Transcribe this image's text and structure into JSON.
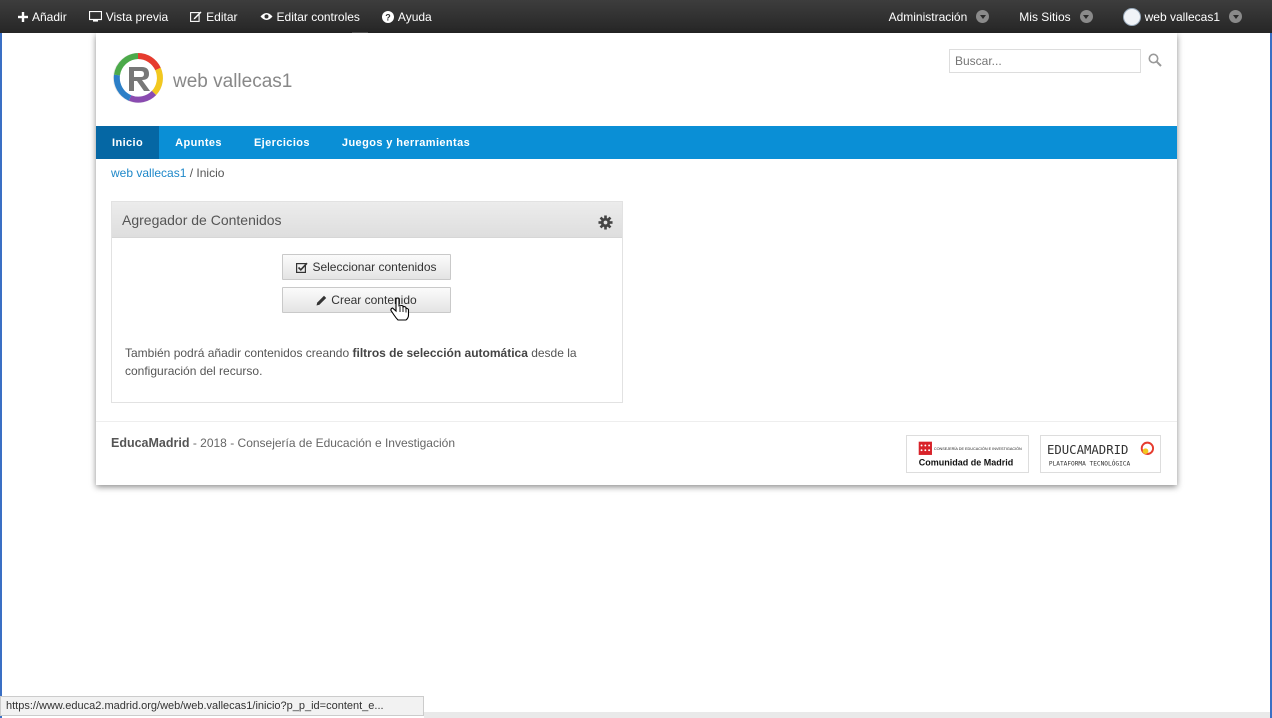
{
  "dockbar": {
    "add": "Añadir",
    "preview": "Vista previa",
    "edit": "Editar",
    "edit_controls": "Editar controles",
    "help": "Ayuda",
    "admin": "Administración",
    "my_sites": "Mis Sitios",
    "user": "web vallecas1"
  },
  "header": {
    "site_name": "web vallecas1",
    "search_placeholder": "Buscar..."
  },
  "nav": {
    "items": [
      {
        "label": "Inicio",
        "active": true
      },
      {
        "label": "Apuntes",
        "active": false
      },
      {
        "label": "Ejercicios",
        "active": false
      },
      {
        "label": "Juegos y herramientas",
        "active": false
      }
    ]
  },
  "breadcrumb": {
    "home": "web vallecas1",
    "separator": " / ",
    "current": "Inicio"
  },
  "portlet": {
    "title": "Agregador de Contenidos",
    "select_button": "Seleccionar contenidos",
    "create_button": "Crear contenido",
    "note_pre": "También podrá añadir contenidos creando ",
    "note_bold": "filtros de selección automática",
    "note_post": " desde la configuración del recurso."
  },
  "footer": {
    "brand": "EducaMadrid",
    "text": " - 2018 - Consejería de Educación e Investigación",
    "logo1_small": "CONSEJERÍA DE EDUCACIÓN E INVESTIGACIÓN",
    "logo1_main": "Comunidad de Madrid",
    "logo2_main": "EDUCAMADRID",
    "logo2_sub": "PLATAFORMA TECNOLÓGICA"
  },
  "status": {
    "url": "https://www.educa2.madrid.org/web/web.vallecas1/inicio?p_p_id=content_e..."
  },
  "colors": {
    "nav_bg": "#0a8fd6",
    "nav_active": "#0567a4",
    "link": "#1e88c9"
  }
}
